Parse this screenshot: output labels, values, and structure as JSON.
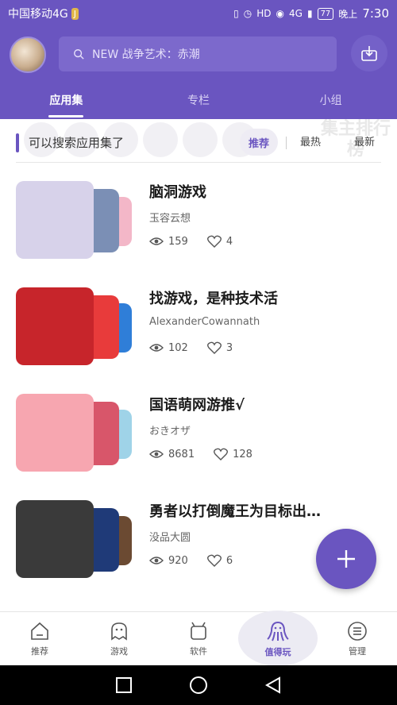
{
  "status_bar": {
    "carrier": "中国移动4G",
    "badge": "J",
    "hd": "HD",
    "network": "4G",
    "battery": "77",
    "time_prefix": "晚上",
    "time": "7:30"
  },
  "header": {
    "search_placeholder": "NEW 战争艺术：赤潮",
    "tabs": [
      {
        "label": "应用集",
        "active": true
      },
      {
        "label": "专栏",
        "active": false
      },
      {
        "label": "小组",
        "active": false
      }
    ]
  },
  "filter": {
    "title": "可以搜索应用集了",
    "sort_options": [
      "推荐",
      "最热",
      "最新"
    ],
    "ranking_ghost": "集主排行榜"
  },
  "items": [
    {
      "title": "脑洞游戏",
      "author": "玉容云想",
      "views": "159",
      "likes": "4",
      "colors": [
        "#d7d2ea",
        "#7b8fb5",
        "#f3b7c8"
      ]
    },
    {
      "title": "找游戏，是种技术活",
      "author": "AlexanderCowannath",
      "views": "102",
      "likes": "3",
      "colors": [
        "#c7252b",
        "#e83b3b",
        "#2f7ed8"
      ]
    },
    {
      "title": "国语萌网游推√",
      "author": "おきオザ",
      "views": "8681",
      "likes": "128",
      "colors": [
        "#f7a6b0",
        "#d8566a",
        "#9fd3e8"
      ]
    },
    {
      "title": "勇者以打倒魔王为目标出…",
      "author": "没品大圆",
      "views": "920",
      "likes": "6",
      "colors": [
        "#3a3a3a",
        "#1f3a78",
        "#6b4a32"
      ]
    }
  ],
  "bottom_nav": [
    {
      "label": "推荐",
      "icon": "home-icon",
      "active": false
    },
    {
      "label": "游戏",
      "icon": "ghost-icon",
      "active": false
    },
    {
      "label": "软件",
      "icon": "android-icon",
      "active": false
    },
    {
      "label": "值得玩",
      "icon": "octopus-icon",
      "active": true
    },
    {
      "label": "管理",
      "icon": "menu-circle-icon",
      "active": false
    }
  ],
  "accent_color": "#6a55c0"
}
